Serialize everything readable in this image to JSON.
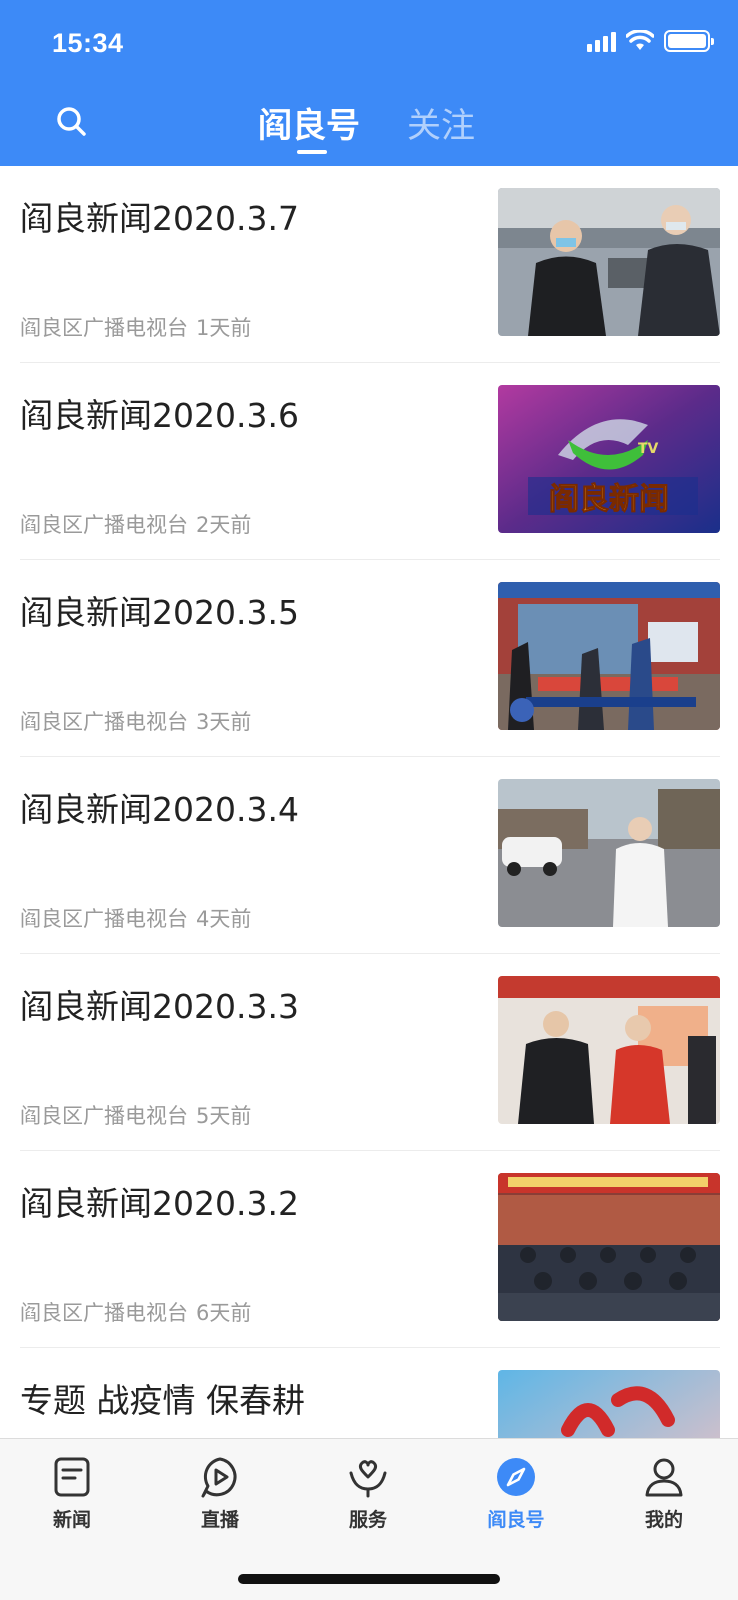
{
  "status_bar": {
    "time": "15:34"
  },
  "header": {
    "tabs": [
      {
        "label": "阎良号",
        "active": true
      },
      {
        "label": "关注",
        "active": false
      }
    ]
  },
  "feed": {
    "items": [
      {
        "title": "阎良新闻2020.3.7",
        "source": "阎良区广播电视台",
        "time": "1天前",
        "thumb": "news-thumb-officials-masks"
      },
      {
        "title": "阎良新闻2020.3.6",
        "source": "阎良区广播电视台",
        "time": "2天前",
        "thumb": "news-thumb-program-logo",
        "thumb_text": "阎良新闻"
      },
      {
        "title": "阎良新闻2020.3.5",
        "source": "阎良区广播电视台",
        "time": "3天前",
        "thumb": "news-thumb-epidemic-checkpoint"
      },
      {
        "title": "阎良新闻2020.3.4",
        "source": "阎良区广播电视台",
        "time": "4天前",
        "thumb": "news-thumb-street-reporter"
      },
      {
        "title": "阎良新闻2020.3.3",
        "source": "阎良区广播电视台",
        "time": "5天前",
        "thumb": "news-thumb-service-hall"
      },
      {
        "title": "阎良新闻2020.3.2",
        "source": "阎良区广播电视台",
        "time": "6天前",
        "thumb": "news-thumb-meeting"
      },
      {
        "title": "专题 战疫情 保春耕",
        "thumb": "special-thumb-red"
      }
    ]
  },
  "tabbar": {
    "items": [
      {
        "label": "新闻",
        "icon": "news-icon",
        "active": false
      },
      {
        "label": "直播",
        "icon": "play-icon",
        "active": false
      },
      {
        "label": "服务",
        "icon": "service-icon",
        "active": false
      },
      {
        "label": "阎良号",
        "icon": "compass-icon",
        "active": true
      },
      {
        "label": "我的",
        "icon": "user-icon",
        "active": false
      }
    ]
  },
  "colors": {
    "brand": "#3d8af7",
    "meta_text": "#9a9a9a",
    "title_text": "#222222"
  }
}
